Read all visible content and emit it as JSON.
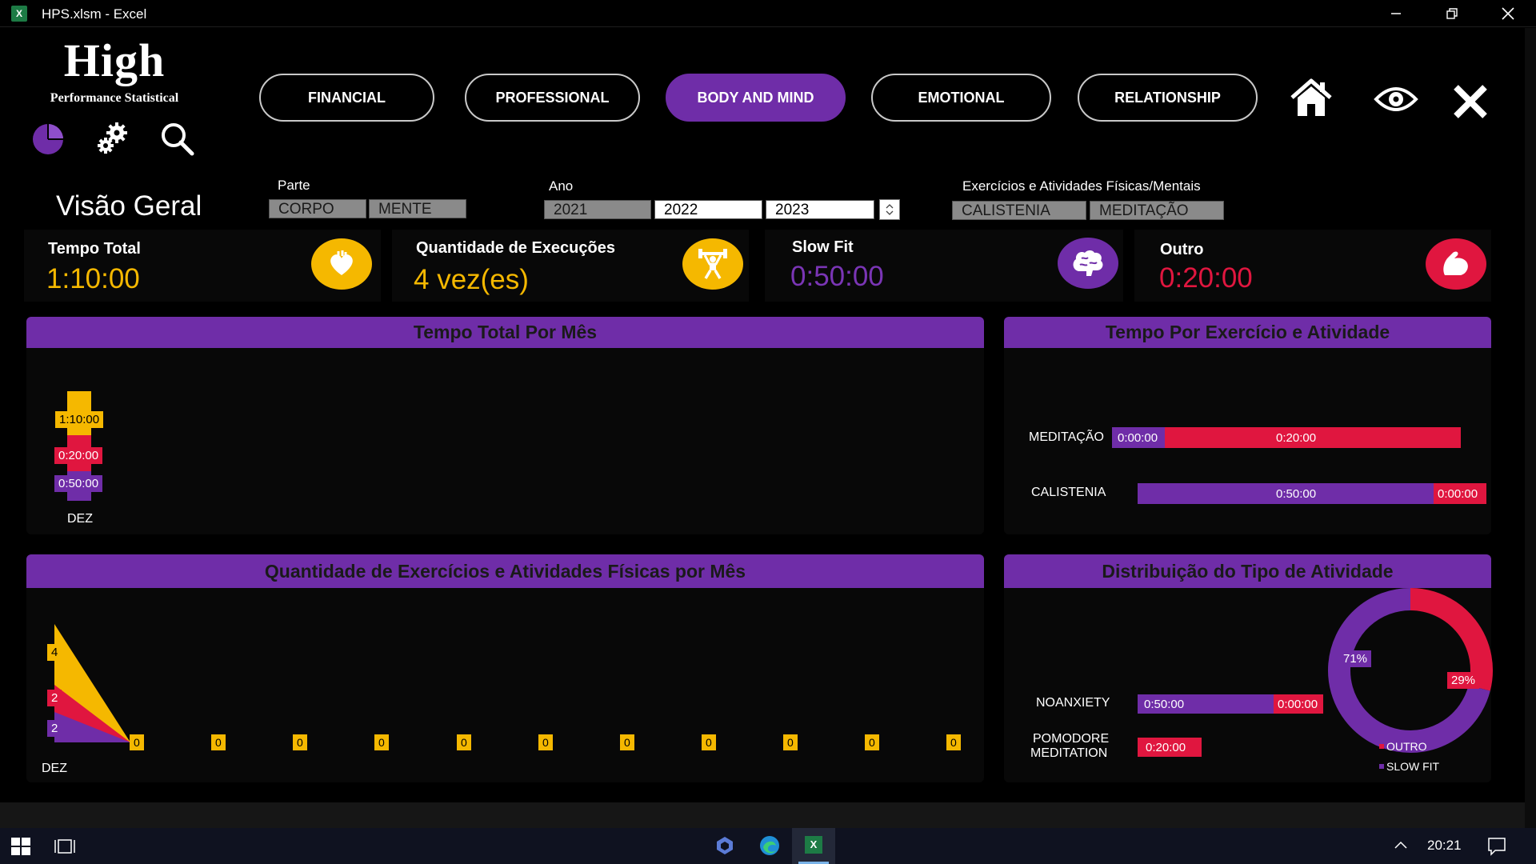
{
  "window": {
    "title": "HPS.xlsm - Excel",
    "app_icon": "excel-icon"
  },
  "logo": {
    "title": "High",
    "subtitle": "Performance Statistical"
  },
  "toolbar_icons": [
    "pie-chart-icon",
    "settings-gears-icon",
    "search-icon"
  ],
  "nav": {
    "tabs": [
      {
        "label": "FINANCIAL",
        "active": false
      },
      {
        "label": "PROFESSIONAL",
        "active": false
      },
      {
        "label": "BODY AND MIND",
        "active": true
      },
      {
        "label": "EMOTIONAL",
        "active": false
      },
      {
        "label": "RELATIONSHIP",
        "active": false
      }
    ],
    "icons": [
      "home-icon",
      "eye-icon",
      "close-x-icon"
    ]
  },
  "overview": {
    "title": "Visão Geral"
  },
  "filters": {
    "parte": {
      "label": "Parte",
      "options": [
        "CORPO",
        "MENTE"
      ]
    },
    "ano": {
      "label": "Ano",
      "options": [
        "2021",
        "2022",
        "2023"
      ],
      "selected": [
        "2022",
        "2023"
      ]
    },
    "exercicios": {
      "label": "Exercícios e Atividades Físicas/Mentais",
      "options": [
        "CALISTENIA",
        "MEDITAÇÃO"
      ]
    }
  },
  "kpis": [
    {
      "title": "Tempo Total",
      "value": "1:10:00",
      "color": "#f5b800",
      "icon": "heart-icon"
    },
    {
      "title": "Quantidade de Execuções",
      "value": "4 vez(es)",
      "color": "#f5b800",
      "icon": "weightlifter-icon"
    },
    {
      "title": "Slow Fit",
      "value": "0:50:00",
      "color": "#7a35b5",
      "icon": "brain-icon"
    },
    {
      "title": "Outro",
      "value": "0:20:00",
      "color": "#e0163f",
      "icon": "flexed-arm-icon"
    }
  ],
  "panels": {
    "p1": "Tempo Total Por Mês",
    "p2": "Tempo Por Exercício e Atividade",
    "p3": "Quantidade de Exercícios e Atividades Físicas por Mês",
    "p4": "Distribuição do Tipo de Atividade"
  },
  "colors": {
    "purple": "#6f2da8",
    "yellow": "#f5b800",
    "red": "#e0163f"
  },
  "chart_data": [
    {
      "type": "bar",
      "title": "Tempo Total Por Mês",
      "categories": [
        "DEZ"
      ],
      "series": [
        {
          "name": "Total",
          "values": [
            "1:10:00"
          ],
          "color": "#f5b800"
        },
        {
          "values": [
            "0:20:00"
          ],
          "color": "#e0163f"
        },
        {
          "values": [
            "0:50:00"
          ],
          "color": "#6f2da8"
        }
      ],
      "data_labels": [
        "1:10:00",
        "0:20:00",
        "0:50:00"
      ],
      "x_label": "DEZ"
    },
    {
      "type": "bar",
      "title": "Tempo Por Exercício e Atividade",
      "categories": [
        "MEDITAÇÃO",
        "CALISTENIA"
      ],
      "series": [
        {
          "values": [
            "0:00:00",
            "0:50:00"
          ],
          "color": "#6f2da8"
        },
        {
          "values": [
            "0:20:00",
            "0:00:00"
          ],
          "color": "#e0163f"
        }
      ]
    },
    {
      "type": "area",
      "title": "Quantidade de Exercícios e Atividades Físicas por Mês",
      "x_label": "DEZ",
      "first_point_labels": [
        "4",
        "2",
        "2"
      ],
      "series": [
        {
          "values": [
            4,
            0
          ],
          "color": "#f5b800"
        },
        {
          "values": [
            2,
            0
          ],
          "color": "#e0163f"
        },
        {
          "values": [
            2,
            0
          ],
          "color": "#6f2da8"
        }
      ],
      "zero_labels": [
        "0",
        "0",
        "0",
        "0",
        "0",
        "0",
        "0",
        "0",
        "0",
        "0",
        "0"
      ]
    },
    {
      "type": "bar",
      "title": "Distribuição do Tipo de Atividade",
      "categories": [
        "NOANXIETY",
        "POMODORE MEDITATION"
      ],
      "series": [
        {
          "values": [
            "0:50:00",
            "0:20:00"
          ],
          "color": "#6f2da8"
        },
        {
          "values": [
            "0:00:00",
            null
          ],
          "color": "#e0163f"
        }
      ]
    },
    {
      "type": "pie",
      "donut": true,
      "slices": [
        {
          "label": "SLOW FIT",
          "value": 71,
          "display": "71%",
          "color": "#6f2da8"
        },
        {
          "label": "OUTRO",
          "value": 29,
          "display": "29%",
          "color": "#e0163f"
        }
      ],
      "legend": [
        "OUTRO",
        "SLOW FIT"
      ]
    }
  ],
  "chart_labels": {
    "c1": {
      "x": "DEZ",
      "lbl": [
        "1:10:00",
        "0:20:00",
        "0:50:00"
      ]
    },
    "c2": {
      "cat": [
        "MEDITAÇÃO",
        "CALISTENIA"
      ],
      "purple": [
        "0:00:00",
        "0:50:00"
      ],
      "red": [
        "0:20:00",
        "0:00:00"
      ]
    },
    "c3": {
      "x": "DEZ",
      "first": [
        "4",
        "2",
        "2"
      ],
      "zeros": [
        "0",
        "0",
        "0",
        "0",
        "0",
        "0",
        "0",
        "0",
        "0",
        "0",
        "0"
      ]
    },
    "c4": {
      "cat1": "NOANXIETY",
      "cat2a": "POMODORE",
      "cat2b": "MEDITATION",
      "purple": [
        "0:50:00",
        "0:20:00"
      ],
      "red": "0:00:00"
    },
    "c5": {
      "purple": "71%",
      "red": "29%",
      "leg_red": "OUTRO",
      "leg_purple": "SLOW FIT"
    }
  },
  "taskbar": {
    "time": "20:21",
    "icons": [
      "windows-start-icon",
      "task-view-icon",
      "copilot-icon",
      "edge-icon",
      "excel-taskbar-icon",
      "chevron-up-icon",
      "notification-icon"
    ]
  }
}
